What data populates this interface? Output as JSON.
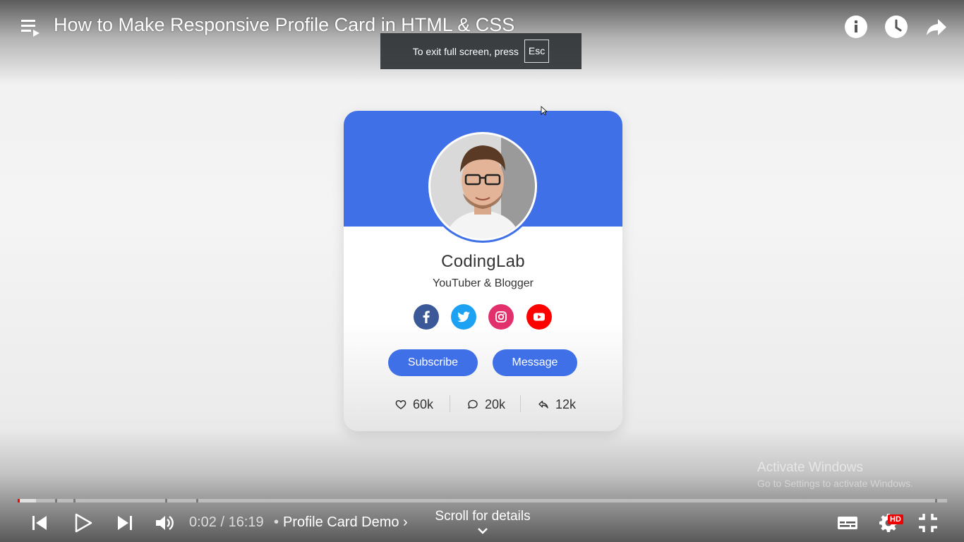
{
  "player": {
    "title": "How to Make Responsive Profile Card in HTML & CSS",
    "fullscreen_tip": "To exit full screen, press",
    "fullscreen_key": "Esc",
    "time_current": "0:02",
    "time_total": "16:19",
    "time_display": "0:02 / 16:19",
    "chapter_separator": "•",
    "chapter_name": "Profile Card Demo ›",
    "scroll_hint": "Scroll for details",
    "quality_badge": "HD",
    "progress_fraction": 0.0021,
    "buffered_fraction": 0.02,
    "accent_color": "#ff0000",
    "icons": [
      "playlist-icon",
      "info-icon",
      "watch-later-icon",
      "share-icon",
      "previous-icon",
      "play-icon",
      "next-icon",
      "volume-icon",
      "subtitles-icon",
      "settings-icon",
      "exit-fullscreen-icon"
    ]
  },
  "card": {
    "name": "CodingLab",
    "role": "YouTuber & Blogger",
    "accent_color": "#4070e8",
    "social": [
      {
        "name": "facebook",
        "color": "#3b5998"
      },
      {
        "name": "twitter",
        "color": "#1da1f2"
      },
      {
        "name": "instagram",
        "color": "#e1306c"
      },
      {
        "name": "youtube",
        "color": "#ff0000"
      }
    ],
    "buttons": {
      "subscribe": "Subscribe",
      "message": "Message"
    },
    "stats": {
      "likes": "60k",
      "comments": "20k",
      "shares": "12k"
    }
  },
  "watermark": {
    "line1": "Activate Windows",
    "line2": "Go to Settings to activate Windows."
  }
}
